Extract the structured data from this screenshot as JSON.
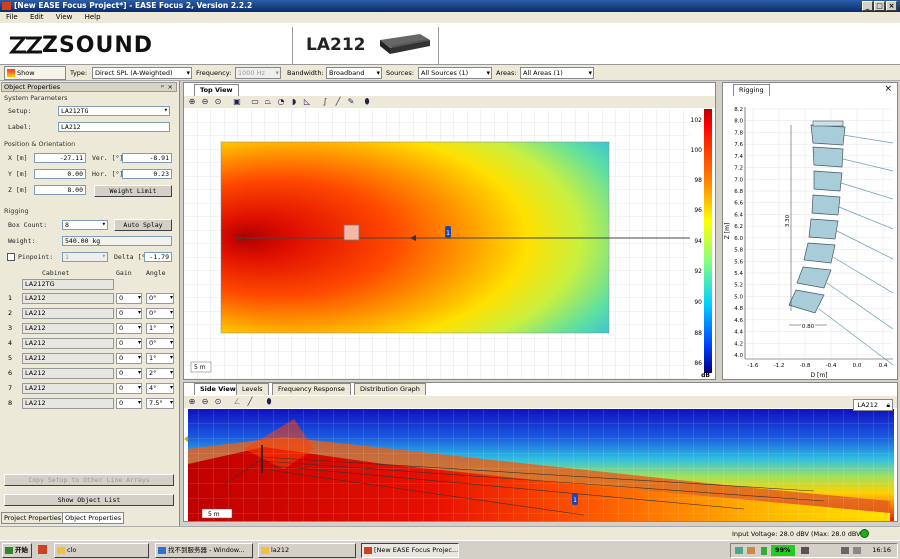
{
  "window": {
    "title": "[New EASE Focus Project*] - EASE Focus 2, Version 2.2.2"
  },
  "menu": [
    "File",
    "Edit",
    "View",
    "Help"
  ],
  "banner": {
    "logo": "ZSOUND",
    "product": "LA212"
  },
  "toolbar": {
    "show_mapping": "Show Mapping",
    "type_label": "Type:",
    "type_value": "Direct SPL (A-Weighted)",
    "frequency_label": "Frequency:",
    "frequency_value": "1000 Hz",
    "bandwidth_label": "Bandwidth:",
    "bandwidth_value": "Broadband",
    "sources_label": "Sources:",
    "sources_value": "All Sources (1)",
    "areas_label": "Areas:",
    "areas_value": "All Areas (1)"
  },
  "left_panel": {
    "title": "Object Properties",
    "system_group": "System Parameters",
    "setup_label": "Setup:",
    "setup_value": "LA212TG",
    "label_label": "Label:",
    "label_value": "LA212",
    "position_group": "Position & Orientation",
    "x_label": "X [m]",
    "x_value": "-27.11",
    "y_label": "Y [m]",
    "y_value": "0.00",
    "z_label": "Z [m]",
    "z_value": "8.00",
    "ver_label": "Ver. [°]",
    "ver_value": "-8.91",
    "hor_label": "Hor. [°]",
    "hor_value": "0.23",
    "weight_limit": "Weight Limit",
    "rigging_group": "Rigging",
    "box_count_label": "Box Count:",
    "box_count_value": "8",
    "auto_splay": "Auto Splay",
    "weight_label": "Weight:",
    "weight_value": "540.00 kg",
    "pinpoint_label": "Pinpoint:",
    "pinpoint_value": "1",
    "delta_label": "Delta [°]",
    "delta_value": "-1.79",
    "col_cabinet": "Cabinet",
    "col_gain": "Gain",
    "col_angle": "Angle",
    "frame": "LA212TG",
    "cabinets": [
      {
        "n": "1",
        "name": "LA212",
        "gain": "0",
        "angle": "0°"
      },
      {
        "n": "2",
        "name": "LA212",
        "gain": "0",
        "angle": "0°"
      },
      {
        "n": "3",
        "name": "LA212",
        "gain": "0",
        "angle": "1°"
      },
      {
        "n": "4",
        "name": "LA212",
        "gain": "0",
        "angle": "0°"
      },
      {
        "n": "5",
        "name": "LA212",
        "gain": "0",
        "angle": "1°"
      },
      {
        "n": "6",
        "name": "LA212",
        "gain": "0",
        "angle": "2°"
      },
      {
        "n": "7",
        "name": "LA212",
        "gain": "0",
        "angle": "4°"
      },
      {
        "n": "8",
        "name": "LA212",
        "gain": "0",
        "angle": "7.5°"
      }
    ],
    "copy_setup": "Copy Setup to Other Line Arrays",
    "show_list": "Show Object List",
    "tabs": [
      "Project Properties",
      "Object Properties"
    ]
  },
  "top_view": {
    "tab": "Top View",
    "scale_label": "5 m",
    "colorbar_ticks": [
      "102",
      "100",
      "98",
      "96",
      "94",
      "92",
      "90",
      "88",
      "86"
    ],
    "colorbar_unit": "dB",
    "source_marker": "1"
  },
  "rigging": {
    "tab": "Rigging",
    "y_ticks": [
      "8.2",
      "8.0",
      "7.8",
      "7.6",
      "7.4",
      "7.2",
      "7.0",
      "6.8",
      "6.6",
      "6.4",
      "6.2",
      "6.0",
      "5.8",
      "5.6",
      "5.4",
      "5.2",
      "5.0",
      "4.8",
      "4.6",
      "4.4",
      "4.2",
      "4.0"
    ],
    "x_ticks": [
      "-1.6",
      "-1.2",
      "-0.8",
      "-0.4",
      "0.0",
      "0.4"
    ],
    "xlabel": "D [m]",
    "ylabel": "Z [m]",
    "height_dim": "3.30",
    "width_dim": "0.80"
  },
  "side_view": {
    "tabs": [
      "Side View",
      "Levels",
      "Frequency Response",
      "Distribution Graph"
    ],
    "source_label": "LA212",
    "scale_label": "5 m",
    "source_marker": "1"
  },
  "status": {
    "text": "Input Voltage: 28.0 dBV (Max: 28.0 dBV)"
  },
  "taskbar": {
    "start": "开始",
    "items": [
      "clo",
      "找不到服务器 - Window...",
      "la212",
      "[New EASE Focus Projec..."
    ],
    "battery": "99%",
    "time": "16:16"
  },
  "colors": {
    "titlebar": "#0a2a6b",
    "panel": "#ece9d8",
    "accent": "#316ac5"
  }
}
